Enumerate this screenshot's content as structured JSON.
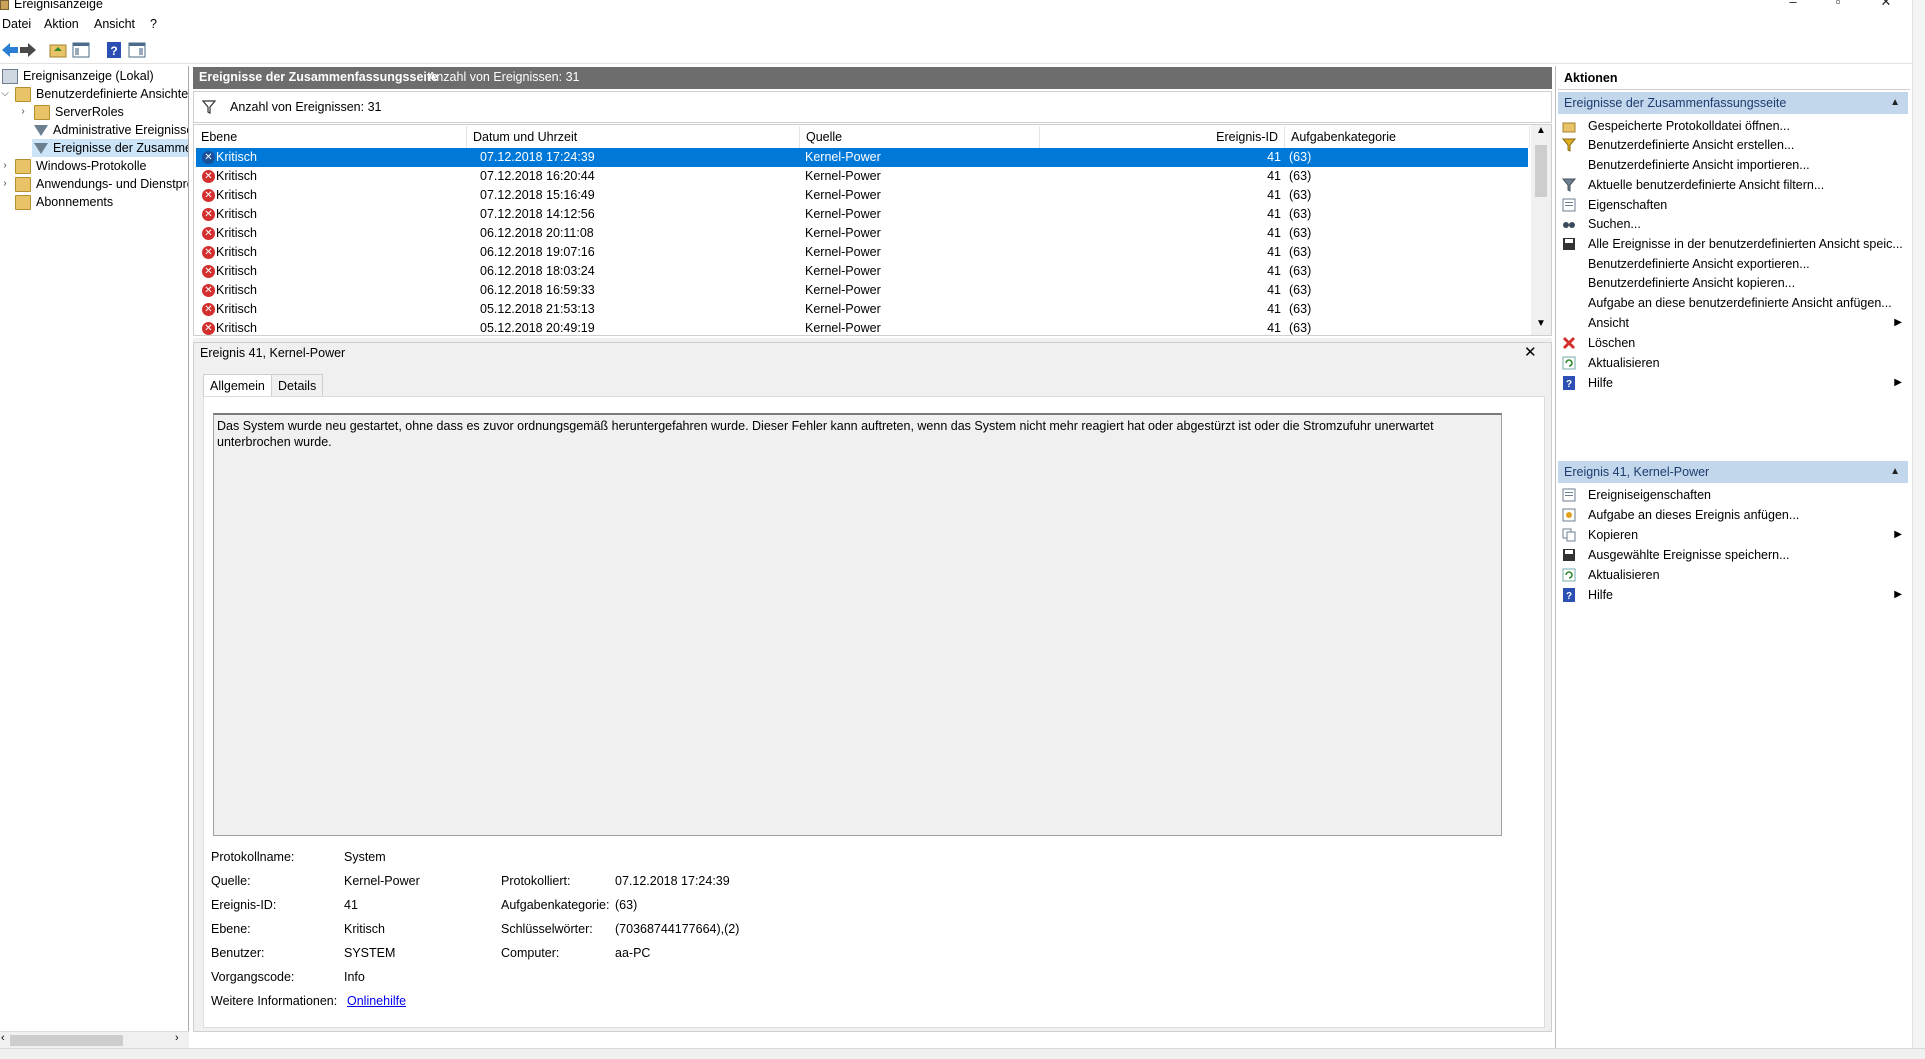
{
  "window": {
    "title": "Ereignisanzeige"
  },
  "menu": [
    "Datei",
    "Aktion",
    "Ansicht",
    "?"
  ],
  "tree": [
    {
      "label": "Ereignisanzeige (Lokal)",
      "icon": "computer-icon"
    },
    {
      "label": "Benutzerdefinierte Ansichten",
      "icon": "folder-icon"
    },
    {
      "label": "ServerRoles",
      "icon": "folder-icon"
    },
    {
      "label": "Administrative Ereignisse",
      "icon": "filter-icon"
    },
    {
      "label": "Ereignisse der Zusammenfassungsseite",
      "icon": "filter-icon"
    },
    {
      "label": "Windows-Protokolle",
      "icon": "folder-icon"
    },
    {
      "label": "Anwendungs- und Dienstprotokolle",
      "icon": "folder-icon"
    },
    {
      "label": "Abonnements",
      "icon": "folder-icon"
    }
  ],
  "center": {
    "header_title": "Ereignisse der Zusammenfassungsseite",
    "header_count": "Anzahl von Ereignissen: 31",
    "filter_text": "Anzahl von Ereignissen: 31",
    "columns": [
      "Ebene",
      "Datum und Uhrzeit",
      "Quelle",
      "Ereignis-ID",
      "Aufgabenkategorie"
    ],
    "rows": [
      [
        "Kritisch",
        "07.12.2018 17:24:39",
        "Kernel-Power",
        "41",
        "(63)"
      ],
      [
        "Kritisch",
        "07.12.2018 16:20:44",
        "Kernel-Power",
        "41",
        "(63)"
      ],
      [
        "Kritisch",
        "07.12.2018 15:16:49",
        "Kernel-Power",
        "41",
        "(63)"
      ],
      [
        "Kritisch",
        "07.12.2018 14:12:56",
        "Kernel-Power",
        "41",
        "(63)"
      ],
      [
        "Kritisch",
        "06.12.2018 20:11:08",
        "Kernel-Power",
        "41",
        "(63)"
      ],
      [
        "Kritisch",
        "06.12.2018 19:07:16",
        "Kernel-Power",
        "41",
        "(63)"
      ],
      [
        "Kritisch",
        "06.12.2018 18:03:24",
        "Kernel-Power",
        "41",
        "(63)"
      ],
      [
        "Kritisch",
        "06.12.2018 16:59:33",
        "Kernel-Power",
        "41",
        "(63)"
      ],
      [
        "Kritisch",
        "05.12.2018 21:53:13",
        "Kernel-Power",
        "41",
        "(63)"
      ],
      [
        "Kritisch",
        "05.12.2018 20:49:19",
        "Kernel-Power",
        "41",
        "(63)"
      ]
    ]
  },
  "detail": {
    "title": "Ereignis 41, Kernel-Power",
    "tabs": [
      "Allgemein",
      "Details"
    ],
    "message": "Das System wurde neu gestartet, ohne dass es zuvor ordnungsgemäß heruntergefahren wurde. Dieser Fehler kann auftreten, wenn das System nicht mehr reagiert hat oder abgestürzt ist oder die Stromzufuhr unerwartet unterbrochen wurde.",
    "labels": {
      "protokollname": "Protokollname:",
      "quelle": "Quelle:",
      "ereignis_id": "Ereignis-ID:",
      "ebene": "Ebene:",
      "benutzer": "Benutzer:",
      "vorgangscode": "Vorgangscode:",
      "weitere": "Weitere Informationen:",
      "protokolliert": "Protokolliert:",
      "aufgabenkategorie": "Aufgabenkategorie:",
      "schluesselwoerter": "Schlüsselwörter:",
      "computer": "Computer:"
    },
    "values": {
      "protokollname": "System",
      "quelle": "Kernel-Power",
      "ereignis_id": "41",
      "ebene": "Kritisch",
      "benutzer": "SYSTEM",
      "vorgangscode": "Info",
      "weitere": "Onlinehilfe",
      "protokolliert": "07.12.2018 17:24:39",
      "aufgabenkategorie": "(63)",
      "schluesselwoerter": "(70368744177664),(2)",
      "computer": "aa-PC"
    }
  },
  "actions": {
    "title": "Aktionen",
    "section1": "Ereignisse der Zusammenfassungsseite",
    "items1": [
      "Gespeicherte Protokolldatei öffnen...",
      "Benutzerdefinierte Ansicht erstellen...",
      "Benutzerdefinierte Ansicht importieren...",
      "Aktuelle benutzerdefinierte Ansicht filtern...",
      "Eigenschaften",
      "Suchen...",
      "Alle Ereignisse in der benutzerdefinierten Ansicht speic...",
      "Benutzerdefinierte Ansicht exportieren...",
      "Benutzerdefinierte Ansicht kopieren...",
      "Aufgabe an diese benutzerdefinierte Ansicht anfügen...",
      "Ansicht",
      "Löschen",
      "Aktualisieren",
      "Hilfe"
    ],
    "section2": "Ereignis 41, Kernel-Power",
    "items2": [
      "Ereigniseigenschaften",
      "Aufgabe an dieses Ereignis anfügen...",
      "Kopieren",
      "Ausgewählte Ereignisse speichern...",
      "Aktualisieren",
      "Hilfe"
    ]
  },
  "colors": {
    "selection": "#0078d7",
    "section_header": "#c3d7ec",
    "critical": "#d32f2f",
    "center_header": "#6d6d6d"
  }
}
